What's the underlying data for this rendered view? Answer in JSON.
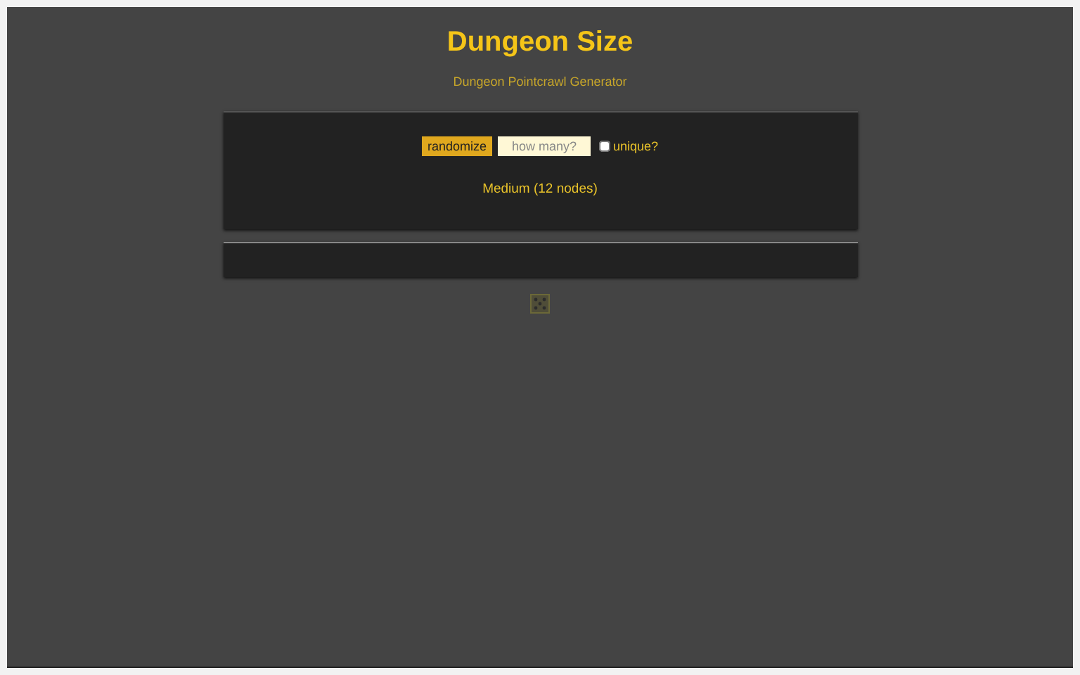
{
  "title": "Dungeon Size",
  "subtitle": "Dungeon Pointcrawl Generator",
  "controls": {
    "randomize": "randomize",
    "count": {
      "placeholder": "how many?"
    },
    "unique": {
      "label": "unique?",
      "checked": false
    }
  },
  "result": "Medium (12 nodes)"
}
